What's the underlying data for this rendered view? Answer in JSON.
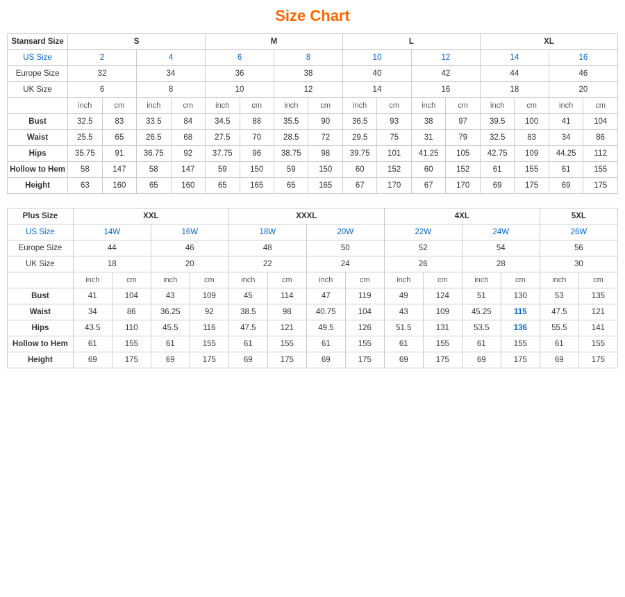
{
  "title": "Size Chart",
  "standard": {
    "label": "Stansard Size",
    "groups": [
      "S",
      "M",
      "L",
      "XL"
    ],
    "us_size_label": "US Size",
    "us_sizes": [
      [
        "2",
        "4"
      ],
      [
        "6",
        "8"
      ],
      [
        "10",
        "12"
      ],
      [
        "14",
        "16"
      ]
    ],
    "europe_size_label": "Europe Size",
    "europe_sizes": [
      [
        "32",
        "34"
      ],
      [
        "36",
        "38"
      ],
      [
        "40",
        "42"
      ],
      [
        "44",
        "46"
      ]
    ],
    "uk_size_label": "UK Size",
    "uk_sizes": [
      [
        "6",
        "8"
      ],
      [
        "10",
        "12"
      ],
      [
        "14",
        "16"
      ],
      [
        "18",
        "20"
      ]
    ],
    "unit_inch": "inch",
    "unit_cm": "cm",
    "measurements": [
      {
        "label": "Bust",
        "values": [
          "32.5",
          "83",
          "33.5",
          "84",
          "34.5",
          "88",
          "35.5",
          "90",
          "36.5",
          "93",
          "38",
          "97",
          "39.5",
          "100",
          "41",
          "104"
        ]
      },
      {
        "label": "Waist",
        "values": [
          "25.5",
          "65",
          "26.5",
          "68",
          "27.5",
          "70",
          "28.5",
          "72",
          "29.5",
          "75",
          "31",
          "79",
          "32.5",
          "83",
          "34",
          "86"
        ]
      },
      {
        "label": "Hips",
        "values": [
          "35.75",
          "91",
          "36.75",
          "92",
          "37.75",
          "96",
          "38.75",
          "98",
          "39.75",
          "101",
          "41.25",
          "105",
          "42.75",
          "109",
          "44.25",
          "112"
        ]
      },
      {
        "label": "Hollow to Hem",
        "values": [
          "58",
          "147",
          "58",
          "147",
          "59",
          "150",
          "59",
          "150",
          "60",
          "152",
          "60",
          "152",
          "61",
          "155",
          "61",
          "155"
        ]
      },
      {
        "label": "Height",
        "values": [
          "63",
          "160",
          "65",
          "160",
          "65",
          "165",
          "65",
          "165",
          "67",
          "170",
          "67",
          "170",
          "69",
          "175",
          "69",
          "175"
        ]
      }
    ]
  },
  "plus": {
    "label": "Plus Size",
    "groups": [
      "XXL",
      "XXXL",
      "4XL",
      "5XL"
    ],
    "us_size_label": "US Size",
    "us_sizes": [
      [
        "14W",
        "16W"
      ],
      [
        "18W",
        "20W"
      ],
      [
        "22W",
        "24W"
      ],
      [
        "26W"
      ]
    ],
    "europe_size_label": "Europe Size",
    "europe_sizes": [
      [
        "44",
        "46"
      ],
      [
        "48",
        "50"
      ],
      [
        "52",
        "54"
      ],
      [
        "56"
      ]
    ],
    "uk_size_label": "UK Size",
    "uk_sizes": [
      [
        "18",
        "20"
      ],
      [
        "22",
        "24"
      ],
      [
        "26",
        "28"
      ],
      [
        "30"
      ]
    ],
    "unit_inch": "inch",
    "unit_cm": "cm",
    "measurements": [
      {
        "label": "Bust",
        "values": [
          "41",
          "104",
          "43",
          "109",
          "45",
          "114",
          "47",
          "119",
          "49",
          "124",
          "51",
          "130",
          "53",
          "135"
        ]
      },
      {
        "label": "Waist",
        "values": [
          "34",
          "86",
          "36.25",
          "92",
          "38.5",
          "98",
          "40.75",
          "104",
          "43",
          "109",
          "45.25",
          "115",
          "47.5",
          "121"
        ]
      },
      {
        "label": "Hips",
        "values": [
          "43.5",
          "110",
          "45.5",
          "116",
          "47.5",
          "121",
          "49.5",
          "126",
          "51.5",
          "131",
          "53.5",
          "136",
          "55.5",
          "141"
        ]
      },
      {
        "label": "Hollow to Hem",
        "values": [
          "61",
          "155",
          "61",
          "155",
          "61",
          "155",
          "61",
          "155",
          "61",
          "155",
          "61",
          "155",
          "61",
          "155"
        ]
      },
      {
        "label": "Height",
        "values": [
          "69",
          "175",
          "69",
          "175",
          "69",
          "175",
          "69",
          "175",
          "69",
          "175",
          "69",
          "175",
          "69",
          "175"
        ]
      }
    ]
  }
}
